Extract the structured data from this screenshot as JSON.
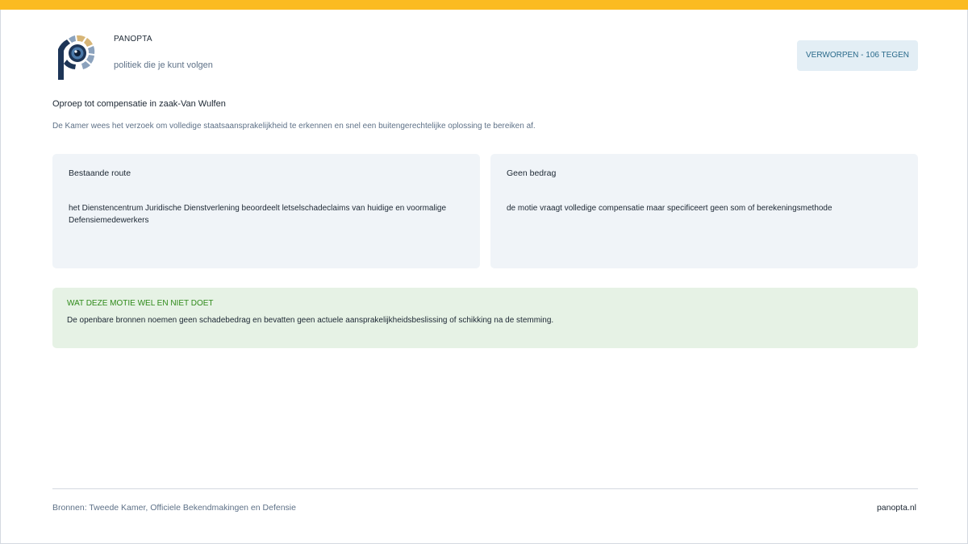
{
  "brand": {
    "name": "PANOPTA",
    "tagline": "politiek die je kunt volgen",
    "logo_icon": "panopta-eye-logo",
    "colors": {
      "navy": "#1d3557",
      "gold": "#d7b576",
      "steel": "#8ba2bd",
      "iris": "#4a78a8"
    }
  },
  "status": {
    "badge": "VERWORPEN - 106 TEGEN"
  },
  "motion": {
    "title": "Oproep tot compensatie in zaak-Van Wulfen",
    "summary": "De Kamer wees het verzoek om volledige staatsaansprakelijkheid te erkennen en snel een buitengerechtelijke oplossing te bereiken af."
  },
  "panels": [
    {
      "heading": "Bestaande route",
      "body": "het Dienstencentrum Juridische Dienstverlening beoordeelt letselschadeclaims van huidige en voormalige Defensiemedewerkers"
    },
    {
      "heading": "Geen bedrag",
      "body": "de motie vraagt volledige compensatie maar specificeert geen som of berekeningsmethode"
    }
  ],
  "note": {
    "heading": "WAT DEZE MOTIE WEL EN NIET DOET",
    "body": "De openbare bronnen noemen geen schadebedrag en bevatten geen actuele aansprakelijkheidsbeslissing of schikking na de stemming."
  },
  "footer": {
    "sources": "Bronnen: Tweede Kamer, Officiele Bekendmakingen en Defensie",
    "site": "panopta.nl"
  },
  "colors": {
    "accent_bar": "#fbbb21",
    "badge_bg": "#e3eef5",
    "badge_text": "#2a6a8b",
    "panel_bg": "#f0f4f8",
    "note_bg": "#e6f2e5",
    "note_heading": "#2f8a1a"
  }
}
